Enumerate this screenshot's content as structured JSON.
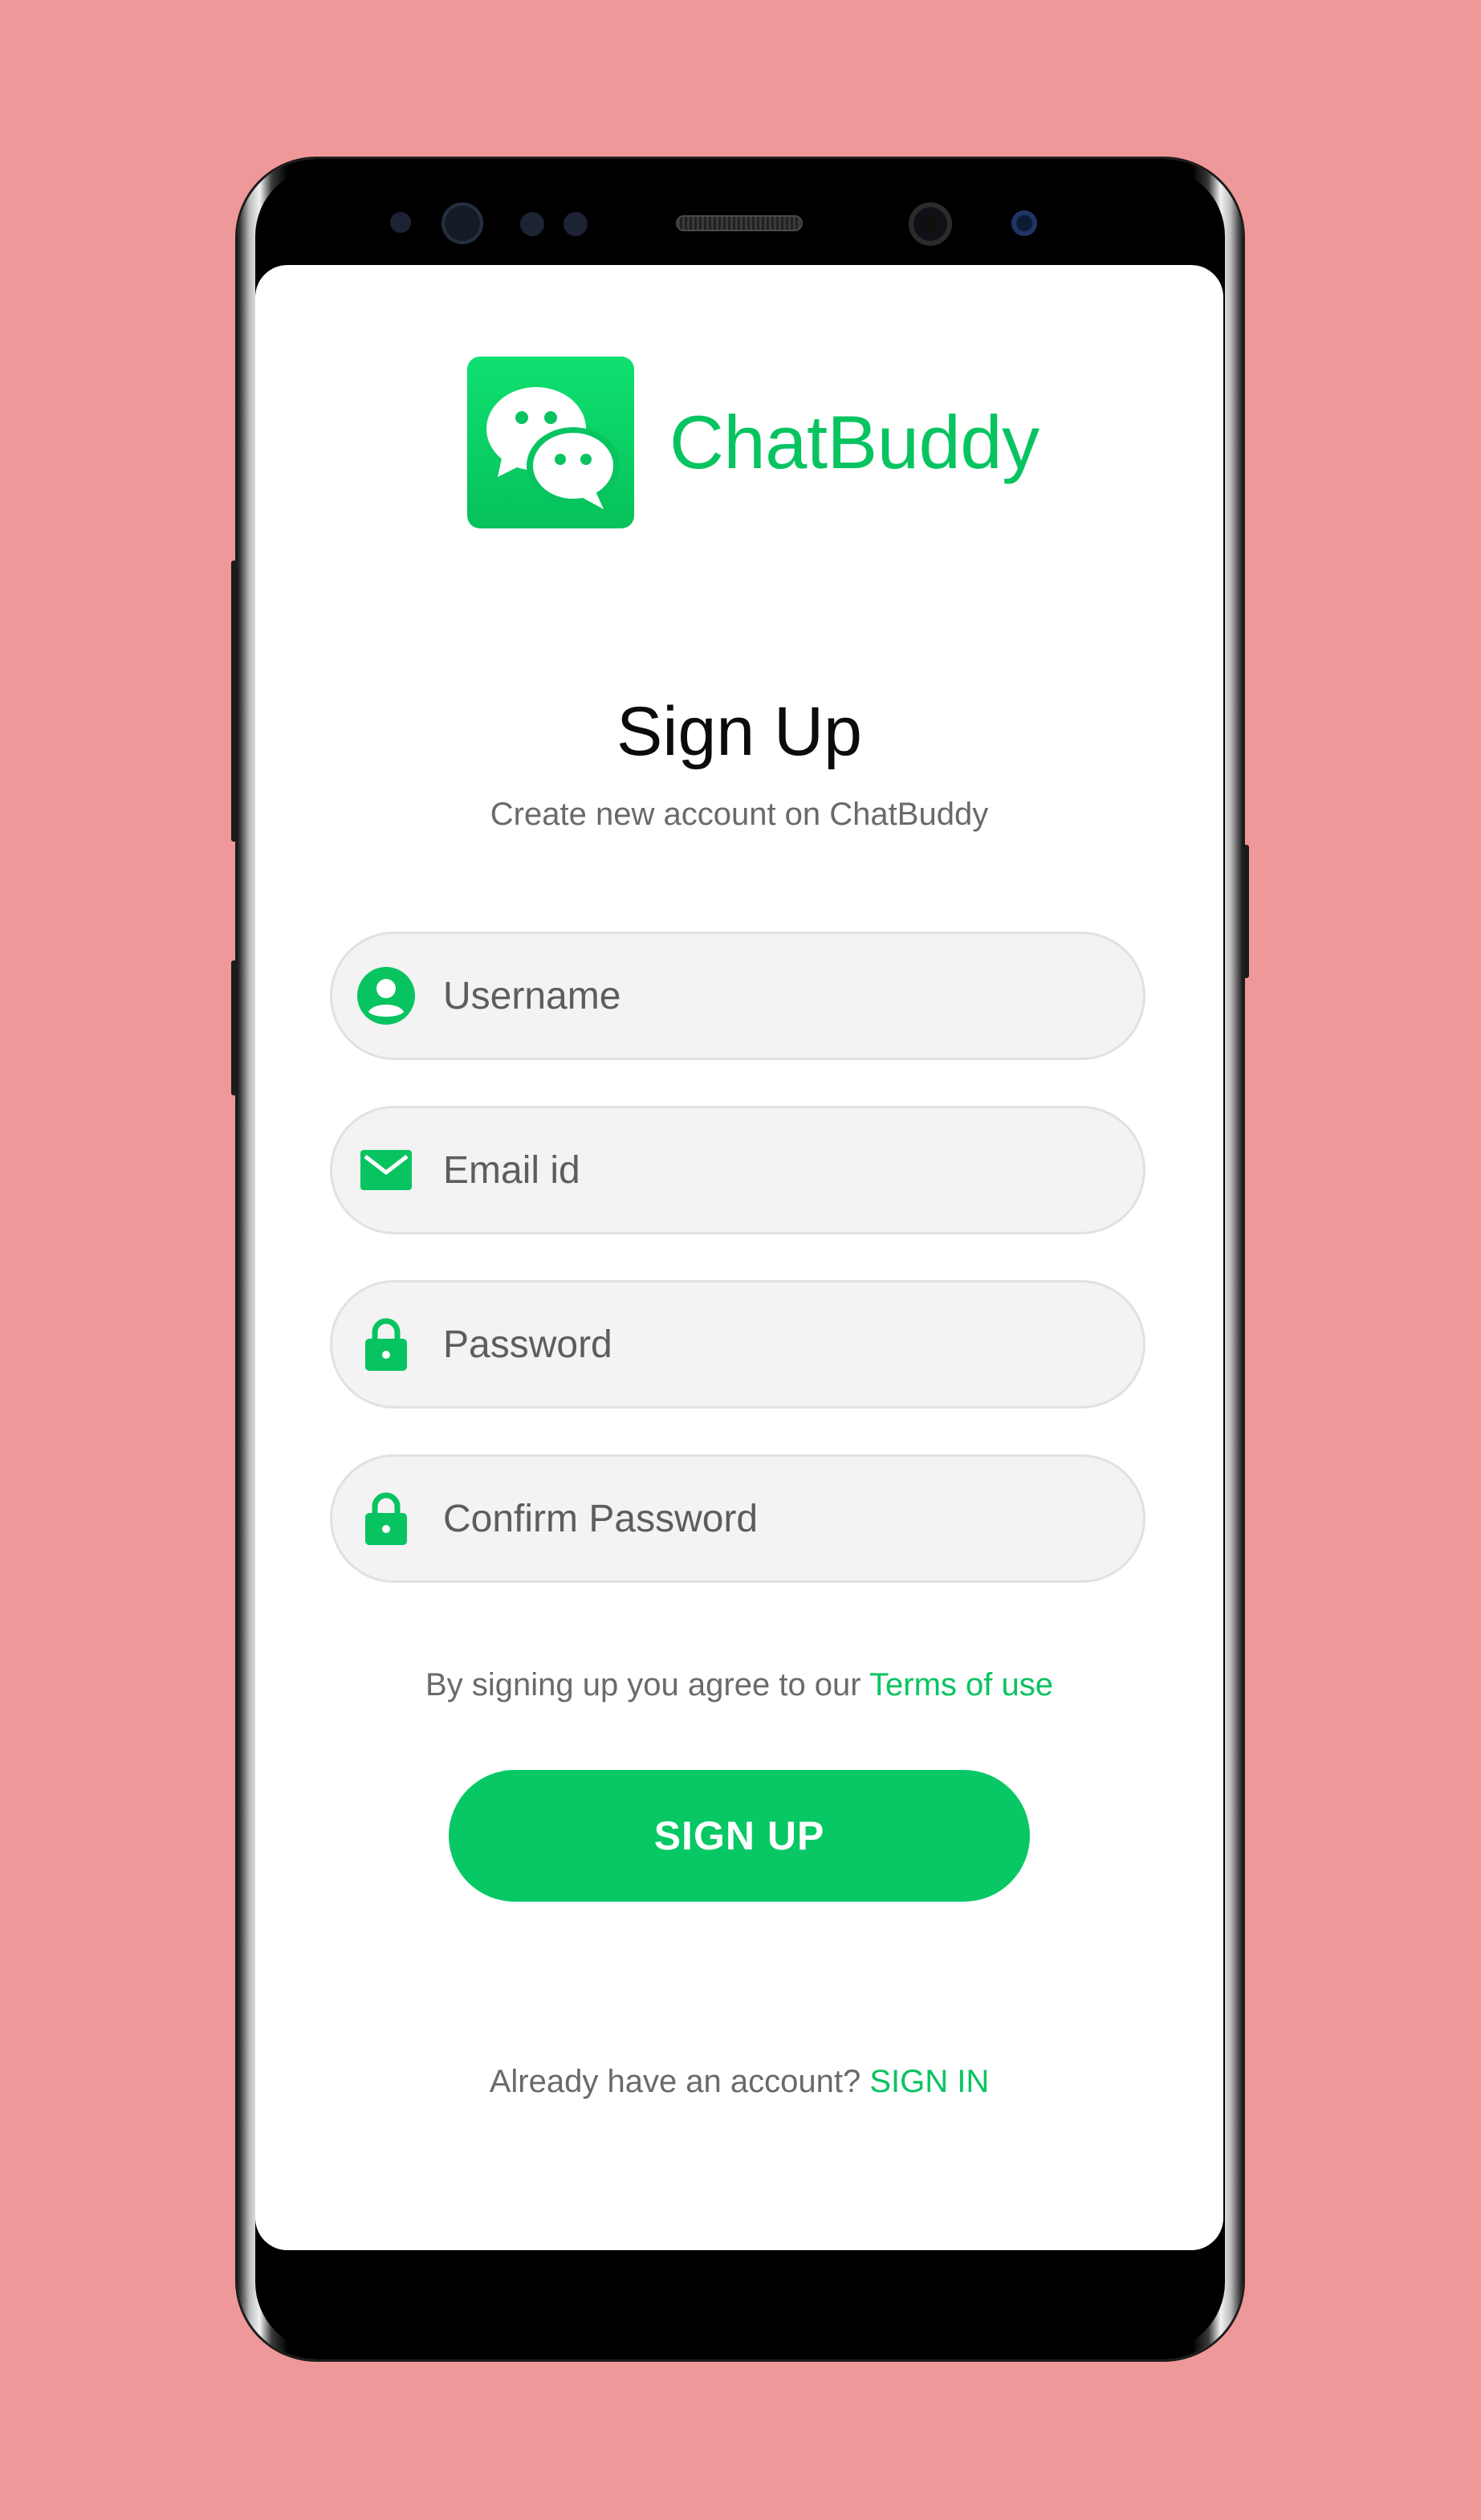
{
  "app": {
    "name": "ChatBuddy",
    "icon": "chat-bubbles-icon",
    "accent_color": "#07c864",
    "background_color": "#ee9899"
  },
  "header": {
    "title": "Sign Up",
    "subtitle": "Create new account on ChatBuddy"
  },
  "form": {
    "fields": [
      {
        "placeholder": "Username",
        "value": "",
        "icon": "user-icon"
      },
      {
        "placeholder": "Email id",
        "value": "",
        "icon": "envelope-icon"
      },
      {
        "placeholder": "Password",
        "value": "",
        "icon": "lock-icon"
      },
      {
        "placeholder": "Confirm Password",
        "value": "",
        "icon": "lock-icon"
      }
    ]
  },
  "terms": {
    "text": "By signing up you agree to our ",
    "link_label": "Terms of use"
  },
  "actions": {
    "signup_label": "SIGN UP"
  },
  "footer": {
    "text": "Already have an account? ",
    "link_label": "SIGN IN"
  }
}
